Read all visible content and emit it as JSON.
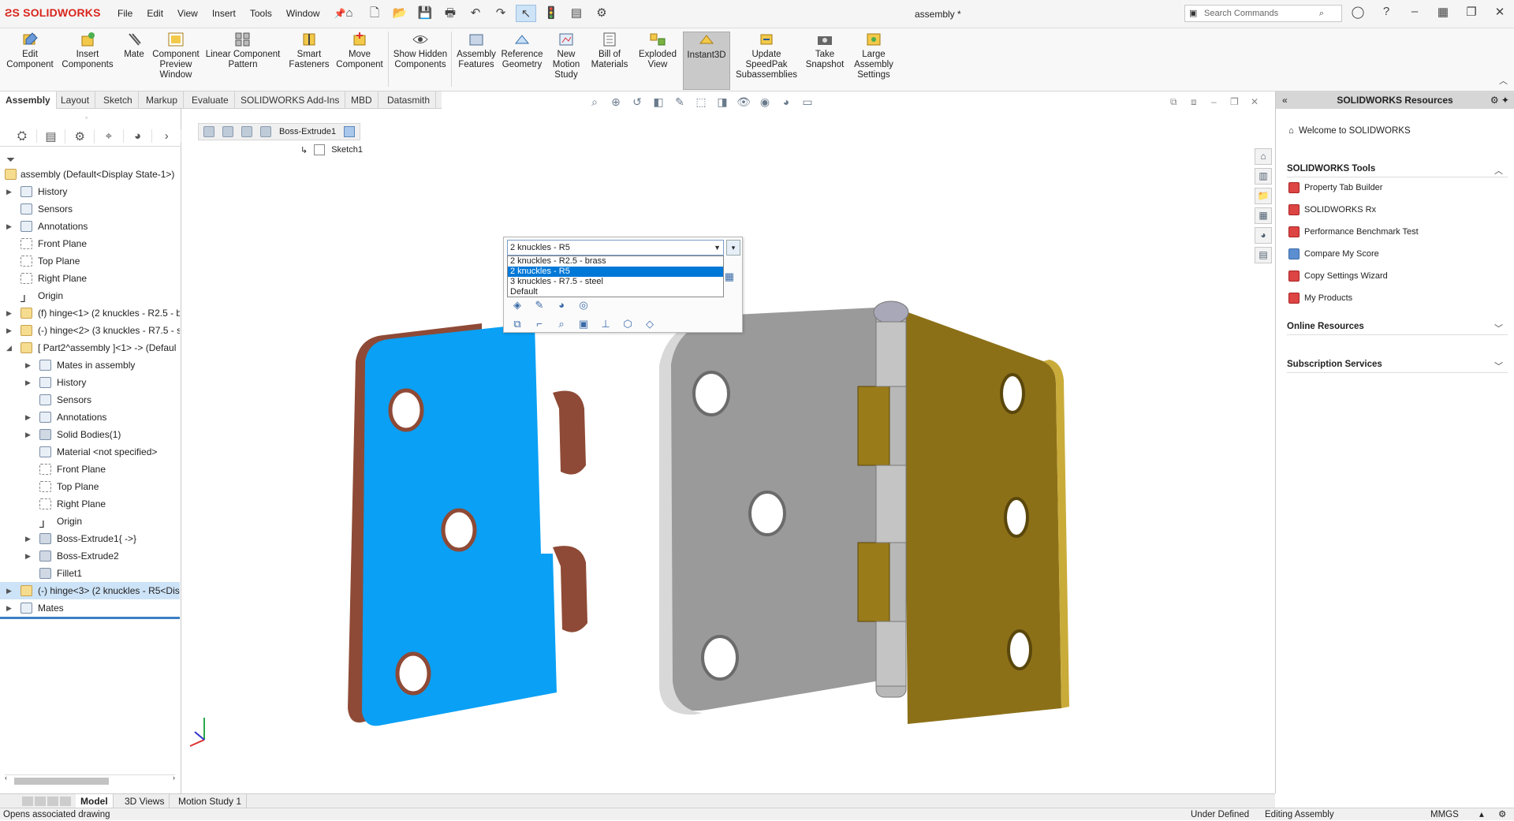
{
  "app": {
    "logo_main": "SOLIDWORKS",
    "document_title": "assembly *"
  },
  "menu": [
    "File",
    "Edit",
    "View",
    "Insert",
    "Tools",
    "Window"
  ],
  "search": {
    "placeholder": "Search Commands"
  },
  "ribbon": [
    {
      "label": "Edit Component"
    },
    {
      "label": "Insert Components"
    },
    {
      "label": "Mate"
    },
    {
      "label": "Component Preview Window"
    },
    {
      "label": "Linear Component Pattern"
    },
    {
      "label": "Smart Fasteners"
    },
    {
      "label": "Move Component"
    },
    {
      "label": "Show Hidden Components"
    },
    {
      "label": "Assembly Features"
    },
    {
      "label": "Reference Geometry"
    },
    {
      "label": "New Motion Study"
    },
    {
      "label": "Bill of Materials"
    },
    {
      "label": "Exploded View"
    },
    {
      "label": "Instant3D"
    },
    {
      "label": "Update SpeedPak Subassemblies"
    },
    {
      "label": "Take Snapshot"
    },
    {
      "label": "Large Assembly Settings"
    }
  ],
  "tabs": [
    "Assembly",
    "Layout",
    "Sketch",
    "Markup",
    "Evaluate",
    "SOLIDWORKS Add-Ins",
    "MBD",
    "Datasmith"
  ],
  "tree": [
    {
      "label": "assembly  (Default<Display State-1>)"
    },
    {
      "label": "History"
    },
    {
      "label": "Sensors"
    },
    {
      "label": "Annotations"
    },
    {
      "label": "Front Plane"
    },
    {
      "label": "Top Plane"
    },
    {
      "label": "Right Plane"
    },
    {
      "label": "Origin"
    },
    {
      "label": "(f) hinge<1> (2 knuckles - R2.5 - b"
    },
    {
      "label": "(-) hinge<2> (3 knuckles - R7.5 - s"
    },
    {
      "label": "[ Part2^assembly ]<1> -> (Defaul"
    },
    {
      "label": "Mates in assembly"
    },
    {
      "label": "History"
    },
    {
      "label": "Sensors"
    },
    {
      "label": "Annotations"
    },
    {
      "label": "Solid Bodies(1)"
    },
    {
      "label": "Material <not specified>"
    },
    {
      "label": "Front Plane"
    },
    {
      "label": "Top Plane"
    },
    {
      "label": "Right Plane"
    },
    {
      "label": "Origin"
    },
    {
      "label": "Boss-Extrude1{ ->}"
    },
    {
      "label": "Boss-Extrude2"
    },
    {
      "label": "Fillet1"
    },
    {
      "label": "(-) hinge<3> (2 knuckles - R5<Dis"
    },
    {
      "label": "Mates"
    }
  ],
  "breadcrumb": {
    "feature": "Boss-Extrude1",
    "sketch": "Sketch1"
  },
  "config": {
    "selected": "2 knuckles - R5",
    "options": [
      "2 knuckles - R2.5 - brass",
      "2 knuckles - R5",
      "3 knuckles - R7.5 - steel",
      "Default"
    ],
    "highlighted": 1
  },
  "task_pane": {
    "title": "SOLIDWORKS Resources",
    "welcome": "Welcome to SOLIDWORKS",
    "tools_heading": "SOLIDWORKS Tools",
    "tools": [
      "Property Tab Builder",
      "SOLIDWORKS Rx",
      "Performance Benchmark Test",
      "Compare My Score",
      "Copy Settings Wizard",
      "My Products"
    ],
    "online_heading": "Online Resources",
    "subscription_heading": "Subscription Services"
  },
  "bottom_tabs": [
    "Model",
    "3D Views",
    "Motion Study 1"
  ],
  "status": {
    "message": "Opens associated drawing",
    "state": "Under Defined",
    "mode": "Editing Assembly",
    "units": "MMGS"
  },
  "colors": {
    "selected_part": "#0aa0f5",
    "steel": "#9a9a9a",
    "brass": "#8c7018",
    "copper": "#8e4a36",
    "accent": "#d9251d"
  }
}
